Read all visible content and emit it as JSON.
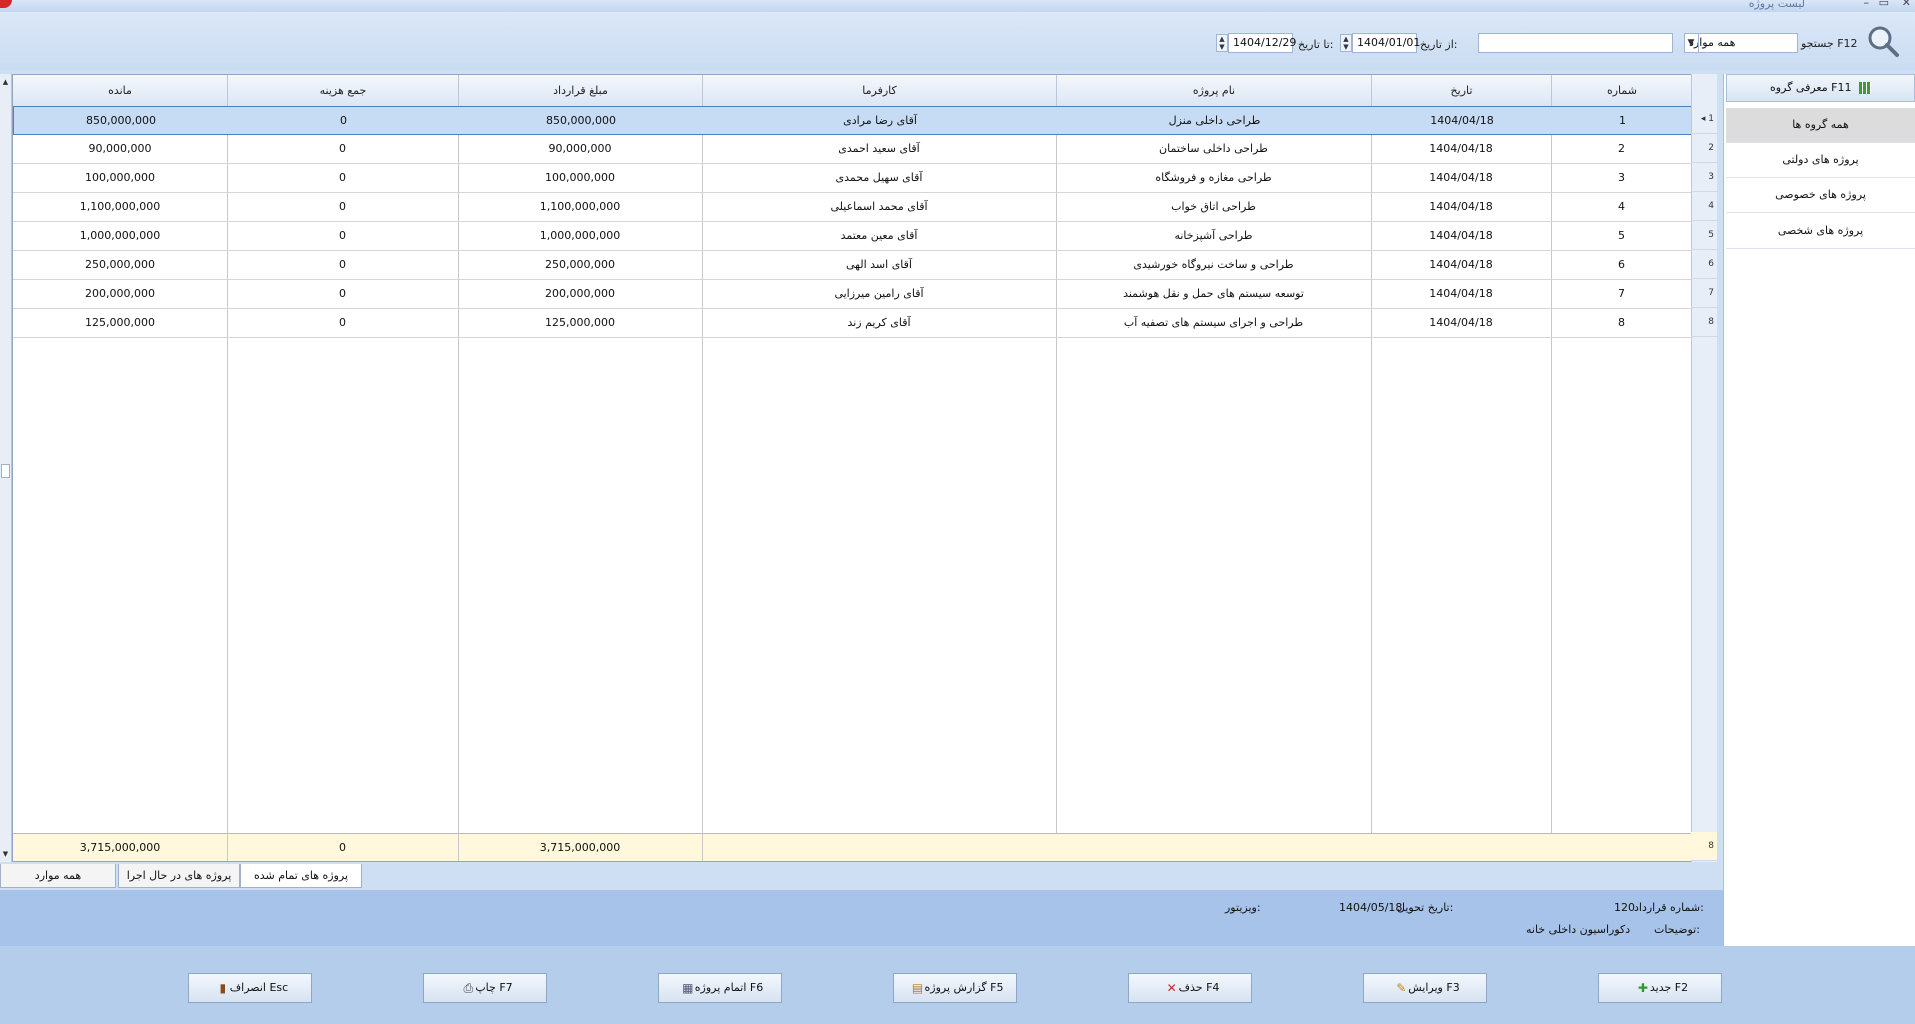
{
  "window": {
    "title": "لیست پروژه"
  },
  "toolbar": {
    "search_label": "جستجو F12",
    "scope_value": "همه موارد",
    "search_value": "",
    "from_label": "از تاریخ:",
    "from_date": "1404/01/01",
    "to_label": "تا تاریخ:",
    "to_date": "1404/12/29"
  },
  "groups": {
    "header": "معرفی گروه F11",
    "items": [
      "همه گروه ها",
      "پروژه های دولتی",
      "پروژه های خصوصی",
      "پروژه های شخصی"
    ]
  },
  "grid": {
    "columns": {
      "number": "شماره",
      "date": "تاریخ",
      "project": "نام پروژه",
      "client": "کارفرما",
      "contract": "مبلغ قرارداد",
      "expense": "جمع هزینه",
      "remaining": "مانده"
    },
    "rows": [
      {
        "ind": "1",
        "number": "1",
        "date": "1404/04/18",
        "project": "طراحی داخلی منزل",
        "client": "آقای رضا مرادی",
        "contract": "850,000,000",
        "expense": "0",
        "remaining": "850,000,000"
      },
      {
        "ind": "2",
        "number": "2",
        "date": "1404/04/18",
        "project": "طراحی داخلی ساختمان",
        "client": "آقای سعید احمدی",
        "contract": "90,000,000",
        "expense": "0",
        "remaining": "90,000,000"
      },
      {
        "ind": "3",
        "number": "3",
        "date": "1404/04/18",
        "project": "طراحی مغازه و فروشگاه",
        "client": "آقای سهیل محمدی",
        "contract": "100,000,000",
        "expense": "0",
        "remaining": "100,000,000"
      },
      {
        "ind": "4",
        "number": "4",
        "date": "1404/04/18",
        "project": "طراحی اتاق خواب",
        "client": "آقای محمد  اسماعیلی",
        "contract": "1,100,000,000",
        "expense": "0",
        "remaining": "1,100,000,000"
      },
      {
        "ind": "5",
        "number": "5",
        "date": "1404/04/18",
        "project": "طراحی آشپزخانه",
        "client": "آقای معین معتمد",
        "contract": "1,000,000,000",
        "expense": "0",
        "remaining": "1,000,000,000"
      },
      {
        "ind": "6",
        "number": "6",
        "date": "1404/04/18",
        "project": "طراحی و ساخت نیروگاه خورشیدی",
        "client": "آقای اسد الهی",
        "contract": "250,000,000",
        "expense": "0",
        "remaining": "250,000,000"
      },
      {
        "ind": "7",
        "number": "7",
        "date": "1404/04/18",
        "project": "توسعه سیستم های حمل و نقل هوشمند",
        "client": "آقای رامین میرزایی",
        "contract": "200,000,000",
        "expense": "0",
        "remaining": "200,000,000"
      },
      {
        "ind": "8",
        "number": "8",
        "date": "1404/04/18",
        "project": "طراحی و اجرای سیستم های تصفیه آب",
        "client": "آقای کریم  زند",
        "contract": "125,000,000",
        "expense": "0",
        "remaining": "125,000,000"
      }
    ],
    "footer": {
      "count": "8",
      "contract_total": "3,715,000,000",
      "expense_total": "0",
      "remaining_total": "3,715,000,000"
    }
  },
  "tabs": [
    "پروژه های تمام شده",
    "پروژه های در حال اجرا",
    "همه موارد"
  ],
  "details": {
    "contract_no_label": "شماره قرارداد:",
    "contract_no": "120",
    "delivery_label": "تاریخ تحویل:",
    "delivery_date": "1404/05/18",
    "visitor_label": "ویزیتور:",
    "visitor": "",
    "notes_label": "توضیحات:",
    "notes": "دکوراسیون داخلی خانه"
  },
  "buttons": {
    "new": "جدید F2",
    "edit": "ویرایش F3",
    "delete": "حذف F4",
    "report": "گزارش پروژه F5",
    "finish": "اتمام پروژه F6",
    "print": "چاپ F7",
    "cancel": "انصراف Esc"
  },
  "colors": {
    "accent": "#4a80c4",
    "selected_row": "#c6dcf5",
    "footer_row": "#fff8dc",
    "panel": "#a7c3ea"
  }
}
